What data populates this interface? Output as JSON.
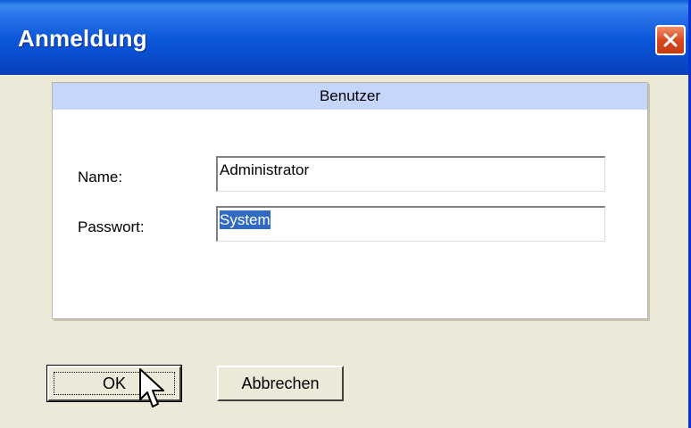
{
  "window": {
    "title": "Anmeldung"
  },
  "panel": {
    "header": "Benutzer",
    "name_label": "Name:",
    "name_value": "Administrator",
    "password_label": "Passwort:",
    "password_value": "System"
  },
  "buttons": {
    "ok_label": "OK",
    "cancel_label": "Abbrechen"
  },
  "icons": {
    "close": "close-icon",
    "cursor": "mouse-cursor-icon"
  },
  "colors": {
    "titlebar": "#0a55d8",
    "panel_header": "#c6d6fa",
    "selection": "#316ac5",
    "close_button": "#d84a20"
  }
}
